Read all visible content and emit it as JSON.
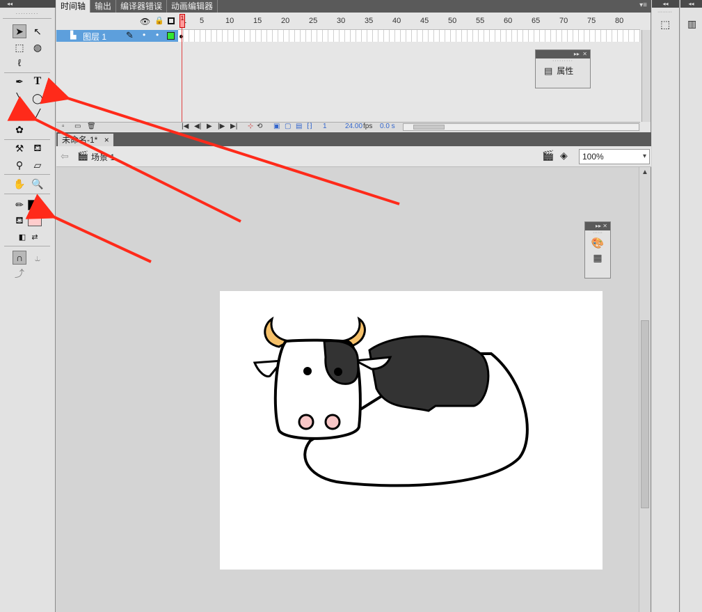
{
  "timeline": {
    "tabs": [
      "时间轴",
      "输出",
      "编译器错误",
      "动画编辑器"
    ],
    "ruler_numbers": [
      "1",
      "5",
      "10",
      "15",
      "20",
      "25",
      "30",
      "35",
      "40",
      "45",
      "50",
      "55",
      "60",
      "65",
      "70",
      "75",
      "80"
    ],
    "layer_name": "图层 1",
    "current_frame": "1",
    "fps": "24.00",
    "fps_unit": "fps",
    "time": "0.0 s"
  },
  "properties_panel": {
    "label": "属性"
  },
  "document": {
    "tab_label": "未命名-1*",
    "close": "×",
    "scene_label": "场景 1",
    "zoom": "100%"
  },
  "colors": {
    "stroke_color": "#000000",
    "fill_color": "#ffcccc",
    "cow_black": "#333333",
    "horn": "#f5c069",
    "nose": "#f7c6c6",
    "arrow": "#ff2a1a"
  }
}
